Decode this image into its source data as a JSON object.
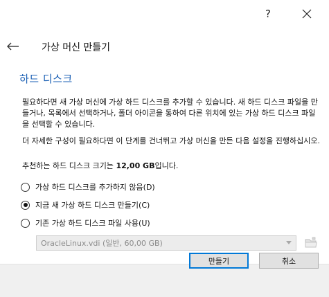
{
  "titlebar": {
    "help_label": "?"
  },
  "header": {
    "title": "가상 머신 만들기"
  },
  "section": {
    "title": "하드 디스크"
  },
  "description": {
    "paragraph1": "필요하다면 새 가상 머신에 가상 하드 디스크를 추가할 수 있습니다. 새 하드 디스크 파일을 만들거나, 목록에서 선택하거나, 폴더 아이콘을 통하여 다른 위치에 있는 가상 하드 디스크 파일을 선택할 수 있습니다.",
    "paragraph2": "더 자세한 구성이 필요하다면 이 단계를 건너뛰고 가상 머신을 만든 다음 설정을 진행하십시오.",
    "recommend_prefix": "추천하는 하드 디스크 크기는 ",
    "recommend_size": "12,00 GB",
    "recommend_suffix": "입니다."
  },
  "options": [
    {
      "label": "가상 하드 디스크를 추가하지 않음(D)",
      "checked": false
    },
    {
      "label": "지금 새 가상 하드 디스크 만들기(C)",
      "checked": true
    },
    {
      "label": "기존 가상 하드 디스크 파일 사용(U)",
      "checked": false
    }
  ],
  "disk_select": {
    "value": "OracleLinux.vdi (일반, 60,00 GB)",
    "disabled": true
  },
  "footer": {
    "create_label": "만들기",
    "cancel_label": "취소"
  },
  "colors": {
    "section_title": "#1a5fb4",
    "default_button_border": "#0078d7",
    "footer_bg": "#f0f0f0"
  }
}
